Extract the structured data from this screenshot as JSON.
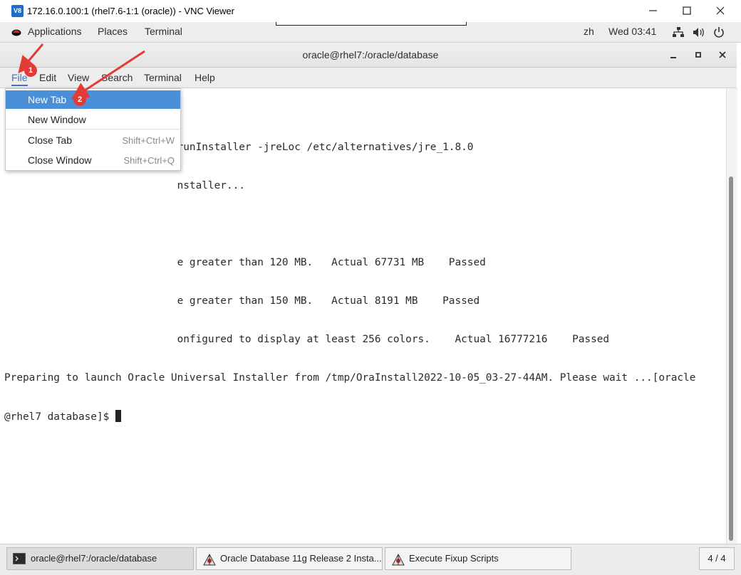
{
  "vnc": {
    "logo_text": "V8",
    "title": "172.16.0.100:1 (rhel7.6-1:1 (oracle)) - VNC Viewer",
    "minimize_icon": "minimize-icon",
    "maximize_icon": "maximize-icon",
    "close_icon": "close-icon"
  },
  "gnome_bar": {
    "applications": "Applications",
    "places": "Places",
    "terminal": "Terminal",
    "input_method": "zh",
    "clock": "Wed 03:41"
  },
  "terminal_window": {
    "title": "oracle@rhel7:/oracle/database"
  },
  "menubar": {
    "file": "File",
    "edit": "Edit",
    "view": "View",
    "search": "Search",
    "terminal": "Terminal",
    "help": "Help"
  },
  "file_menu": {
    "items": [
      {
        "label": "New Tab",
        "shortcut": ""
      },
      {
        "label": "New Window",
        "shortcut": ""
      },
      {
        "label": "Close Tab",
        "shortcut": "Shift+Ctrl+W"
      },
      {
        "label": "Close Window",
        "shortcut": "Shift+Ctrl+Q"
      }
    ]
  },
  "terminal_output": {
    "lines": [
      "                            runInstaller -jreLoc /etc/alternatives/jre_1.8.0",
      "                            nstaller...",
      "",
      "                            e greater than 120 MB.   Actual 67731 MB    Passed",
      "                            e greater than 150 MB.   Actual 8191 MB    Passed",
      "                            onfigured to display at least 256 colors.    Actual 16777216    Passed",
      "Preparing to launch Oracle Universal Installer from /tmp/OraInstall2022-10-05_03-27-44AM. Please wait ...[oracle",
      "@rhel7 database]$ "
    ]
  },
  "annotations": {
    "marker1": "1",
    "marker2": "2",
    "color": "#e23a35"
  },
  "taskbar": {
    "tasks": [
      {
        "label": "oracle@rhel7:/oracle/database",
        "icon": "terminal-icon"
      },
      {
        "label": "Oracle Database 11g Release 2 Insta...",
        "icon": "java-installer-icon"
      },
      {
        "label": "Execute Fixup Scripts",
        "icon": "java-installer-icon"
      }
    ],
    "pager": "4 / 4"
  }
}
